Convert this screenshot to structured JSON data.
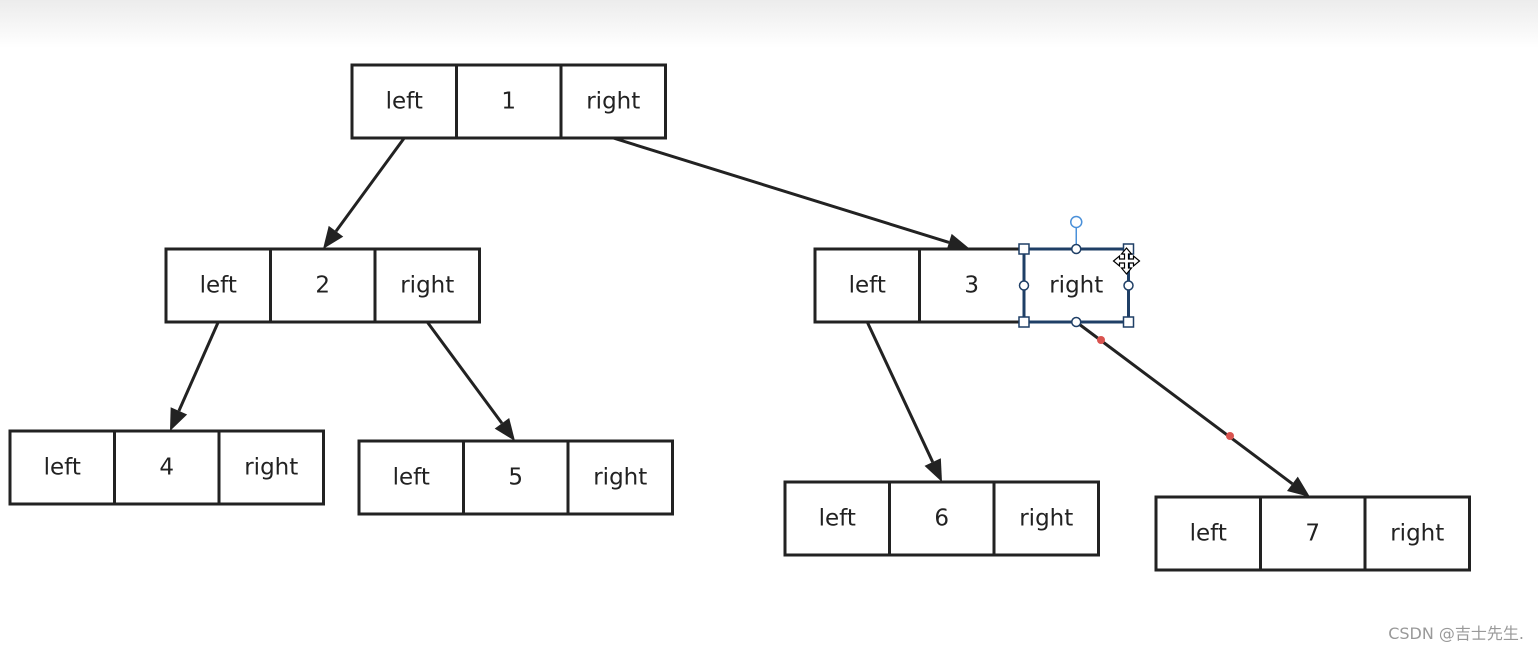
{
  "diagram": {
    "cell_labels": {
      "left": "left",
      "right": "right"
    },
    "nodes": [
      {
        "id": "1",
        "value": "1"
      },
      {
        "id": "2",
        "value": "2"
      },
      {
        "id": "3",
        "value": "3"
      },
      {
        "id": "4",
        "value": "4"
      },
      {
        "id": "5",
        "value": "5"
      },
      {
        "id": "6",
        "value": "6"
      },
      {
        "id": "7",
        "value": "7"
      }
    ],
    "edges": [
      {
        "from": "1",
        "side": "left",
        "to": "2"
      },
      {
        "from": "1",
        "side": "right",
        "to": "3"
      },
      {
        "from": "2",
        "side": "left",
        "to": "4"
      },
      {
        "from": "2",
        "side": "right",
        "to": "5"
      },
      {
        "from": "3",
        "side": "left",
        "to": "6"
      },
      {
        "from": "3",
        "side": "right",
        "to": "7"
      }
    ],
    "selected": {
      "node": "3",
      "cell": "right"
    },
    "colors": {
      "stroke": "#222222",
      "selection": "#1f3f66",
      "handle": "#4a90d9",
      "edge_point": "#d9534f"
    }
  },
  "watermark": "CSDN @吉士先生."
}
